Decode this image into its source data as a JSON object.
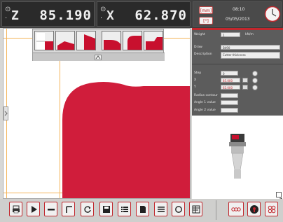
{
  "readout": {
    "axis_z": {
      "label": "Z",
      "value": "85.190"
    },
    "axis_x": {
      "label": "X",
      "value": "62.870"
    }
  },
  "status": {
    "mode_button": "[mm]",
    "unit_button": "[°]",
    "time": "08:10",
    "date": "05/05/2013"
  },
  "panel": {
    "rows": [
      {
        "label": "Weight",
        "value": "1",
        "unit": "kN/m"
      },
      {
        "label": "Draw",
        "value": "B490"
      },
      {
        "label": "Description",
        "value": "Cutter thickness"
      },
      {
        "label": "Step",
        "value": "0"
      },
      {
        "label": "X",
        "value": "85.000"
      },
      {
        "label": "Y",
        "value": "62.000"
      },
      {
        "label": "Radius contour",
        "value": ""
      },
      {
        "label": "Angle 1 value",
        "value": ""
      },
      {
        "label": "Angle 2 value",
        "value": ""
      }
    ]
  },
  "colors": {
    "accent": "#c8102e",
    "guide": "#f4b45a",
    "panel": "#5c5c5c"
  },
  "toolbar": {
    "buttons": [
      "print-icon",
      "play-icon",
      "line-icon",
      "corner-icon",
      "refresh-icon",
      "save-icon",
      "list-icon",
      "file-icon",
      "menu-icon",
      "cycle-icon",
      "table-icon"
    ],
    "right_buttons": [
      "chain-icon",
      "info-icon",
      "grid-icon"
    ]
  }
}
